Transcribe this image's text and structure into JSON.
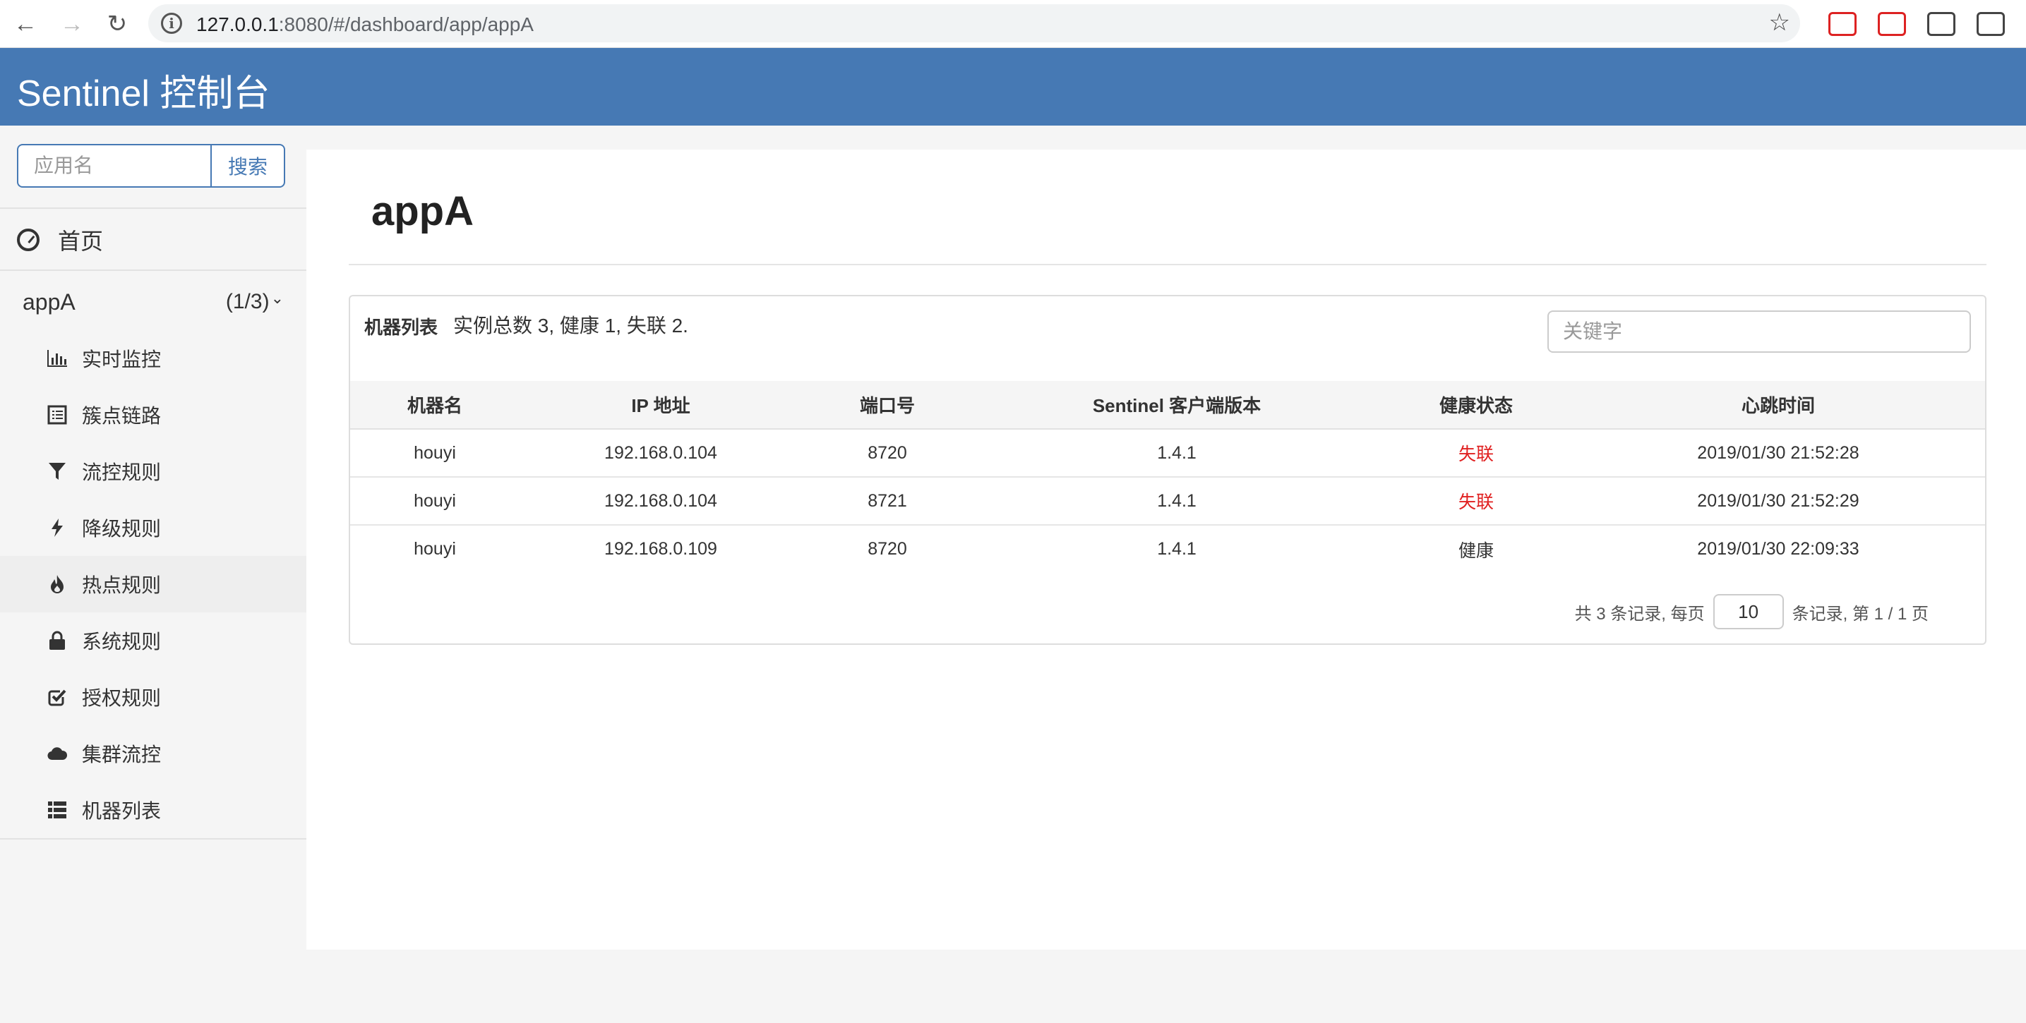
{
  "browser": {
    "url_host": "127.0.0.1",
    "url_rest": ":8080/#/dashboard/app/appA"
  },
  "header": {
    "title": "Sentinel 控制台"
  },
  "sidebar": {
    "search_placeholder": "应用名",
    "search_button": "搜索",
    "home_label": "首页",
    "app": {
      "name": "appA",
      "count": "(1/3)"
    },
    "menu": [
      {
        "label": "实时监控",
        "icon": "bar-chart-icon"
      },
      {
        "label": "簇点链路",
        "icon": "list-alt-icon"
      },
      {
        "label": "流控规则",
        "icon": "filter-icon"
      },
      {
        "label": "降级规则",
        "icon": "flash-icon"
      },
      {
        "label": "热点规则",
        "icon": "fire-icon"
      },
      {
        "label": "系统规则",
        "icon": "lock-icon"
      },
      {
        "label": "授权规则",
        "icon": "check-icon"
      },
      {
        "label": "集群流控",
        "icon": "cloud-icon"
      },
      {
        "label": "机器列表",
        "icon": "th-list-icon"
      }
    ]
  },
  "main": {
    "title": "appA",
    "panel": {
      "label": "机器列表",
      "summary": "实例总数 3, 健康 1, 失联 2.",
      "keyword_placeholder": "关键字",
      "columns": [
        "机器名",
        "IP 地址",
        "端口号",
        "Sentinel 客户端版本",
        "健康状态",
        "心跳时间"
      ],
      "rows": [
        {
          "host": "houyi",
          "ip": "192.168.0.104",
          "port": "8720",
          "version": "1.4.1",
          "status": "失联",
          "heartbeat": "2019/01/30 21:52:28"
        },
        {
          "host": "houyi",
          "ip": "192.168.0.104",
          "port": "8721",
          "version": "1.4.1",
          "status": "失联",
          "heartbeat": "2019/01/30 21:52:29"
        },
        {
          "host": "houyi",
          "ip": "192.168.0.109",
          "port": "8720",
          "version": "1.4.1",
          "status": "健康",
          "heartbeat": "2019/01/30 22:09:33"
        }
      ],
      "pager": {
        "prefix": "共 3 条记录, 每页",
        "page_size": "10",
        "suffix": "条记录, 第 1 / 1 页"
      }
    }
  },
  "colors": {
    "header_bg": "#4679b4",
    "lost_status": "#e02020",
    "healthy_status": "#333333"
  }
}
